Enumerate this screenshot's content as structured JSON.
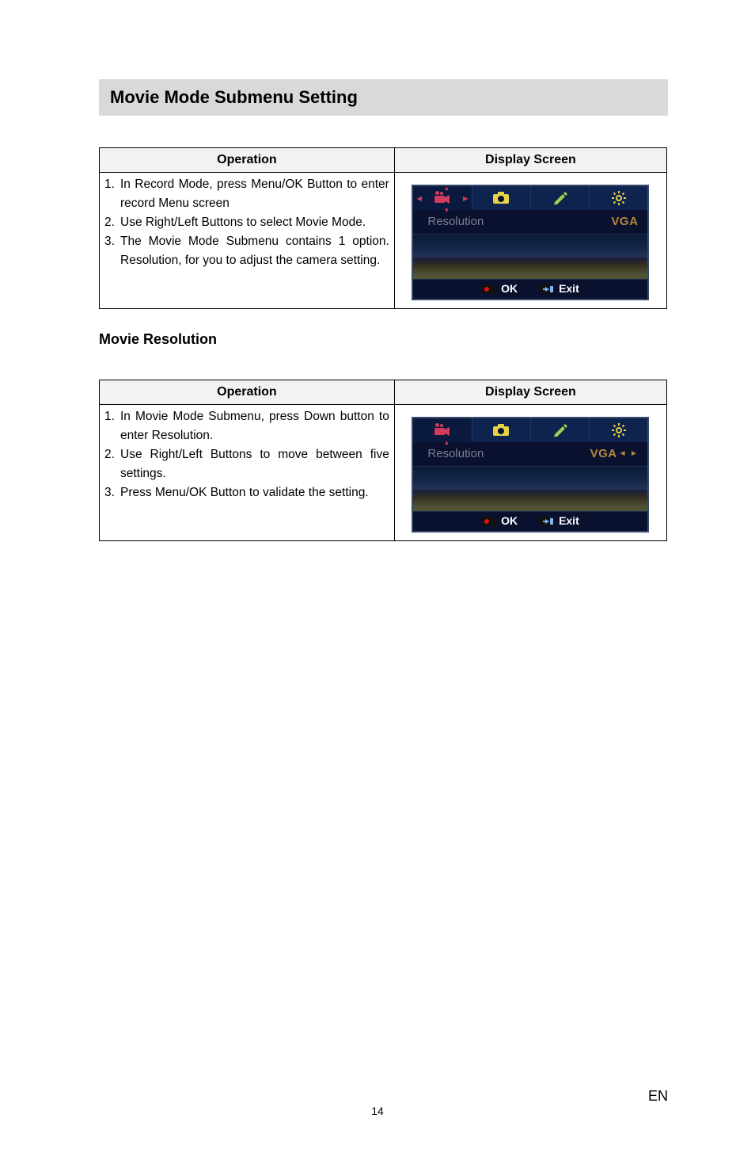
{
  "section1": {
    "heading": "Movie Mode Submenu Setting",
    "operation_header": "Operation",
    "display_header": "Display Screen",
    "steps": [
      {
        "n": "1.",
        "text": "In Record Mode, press Menu/OK Button to enter record Menu screen"
      },
      {
        "n": "2.",
        "text": "Use Right/Left Buttons to select Movie Mode."
      },
      {
        "n": "3.",
        "text": "The Movie Mode Submenu contains 1 option. Resolution, for you to adjust the camera setting."
      }
    ],
    "screen": {
      "resolution_label": "Resolution",
      "resolution_value": "VGA",
      "ok_label": "OK",
      "exit_label": "Exit",
      "show_side_arrows": true,
      "show_value_arrows": false
    }
  },
  "section2": {
    "heading": "Movie Resolution",
    "operation_header": "Operation",
    "display_header": "Display Screen",
    "steps": [
      {
        "n": "1.",
        "text": "In Movie Mode Submenu, press Down button to enter Resolution."
      },
      {
        "n": "2.",
        "text": "Use Right/Left Buttons to move between five settings."
      },
      {
        "n": "3.",
        "text": "Press Menu/OK Button to validate the setting."
      }
    ],
    "screen": {
      "resolution_label": "Resolution",
      "resolution_value": "VGA",
      "ok_label": "OK",
      "exit_label": "Exit",
      "show_side_arrows": false,
      "show_value_arrows": true
    }
  },
  "footer": {
    "page_number": "14",
    "lang": "EN"
  },
  "icons": {
    "movie": "movie-icon",
    "camera": "camera-icon",
    "pen": "pen-icon",
    "gear": "gear-icon",
    "rec": "rec-icon",
    "exit_arrow": "exit-icon"
  }
}
